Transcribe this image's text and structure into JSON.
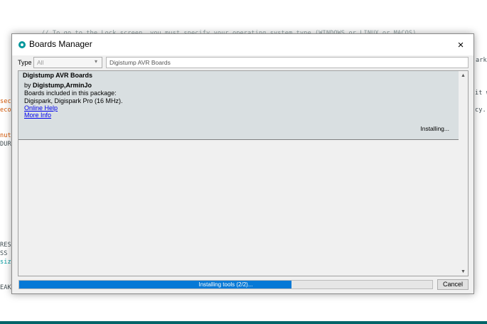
{
  "background": {
    "top_line": "// To go to the Lock screen, you must specify your operating system type (WINDOWS or LINUX or MACOS).",
    "right_1": "ark_",
    "right_2": "it w",
    "right_3": "cy.",
    "left_1": "seco",
    "left_2": "econ",
    "left_3": "nute",
    "left_4": "DURA",
    "left_5": "RESS",
    "left_6": "SS",
    "left_7": "size",
    "left_8": "EAK"
  },
  "dialog": {
    "title": "Boards Manager",
    "close_icon": "×",
    "filter": {
      "type_label": "Type",
      "type_value": "All",
      "search_value": "Digistump AVR Boards"
    },
    "board": {
      "name": "Digistump AVR Boards",
      "by_prefix": "by ",
      "authors": "Digistump,ArminJo",
      "included_label": "Boards included in this package:",
      "boards": "Digispark, Digispark Pro (16 MHz).",
      "online_help": "Online Help",
      "more_info": "More Info",
      "status": "Installing..."
    },
    "scroll_up_icon": "▲",
    "scroll_down_icon": "▼",
    "progress": {
      "label": "Installing tools (2/2)...",
      "fraction": 0.66
    },
    "cancel_label": "Cancel"
  },
  "colors": {
    "accent": "#0679d6",
    "link": "#0000ee",
    "item_bg": "#d9dfe1",
    "arduino_teal": "#00979c"
  }
}
